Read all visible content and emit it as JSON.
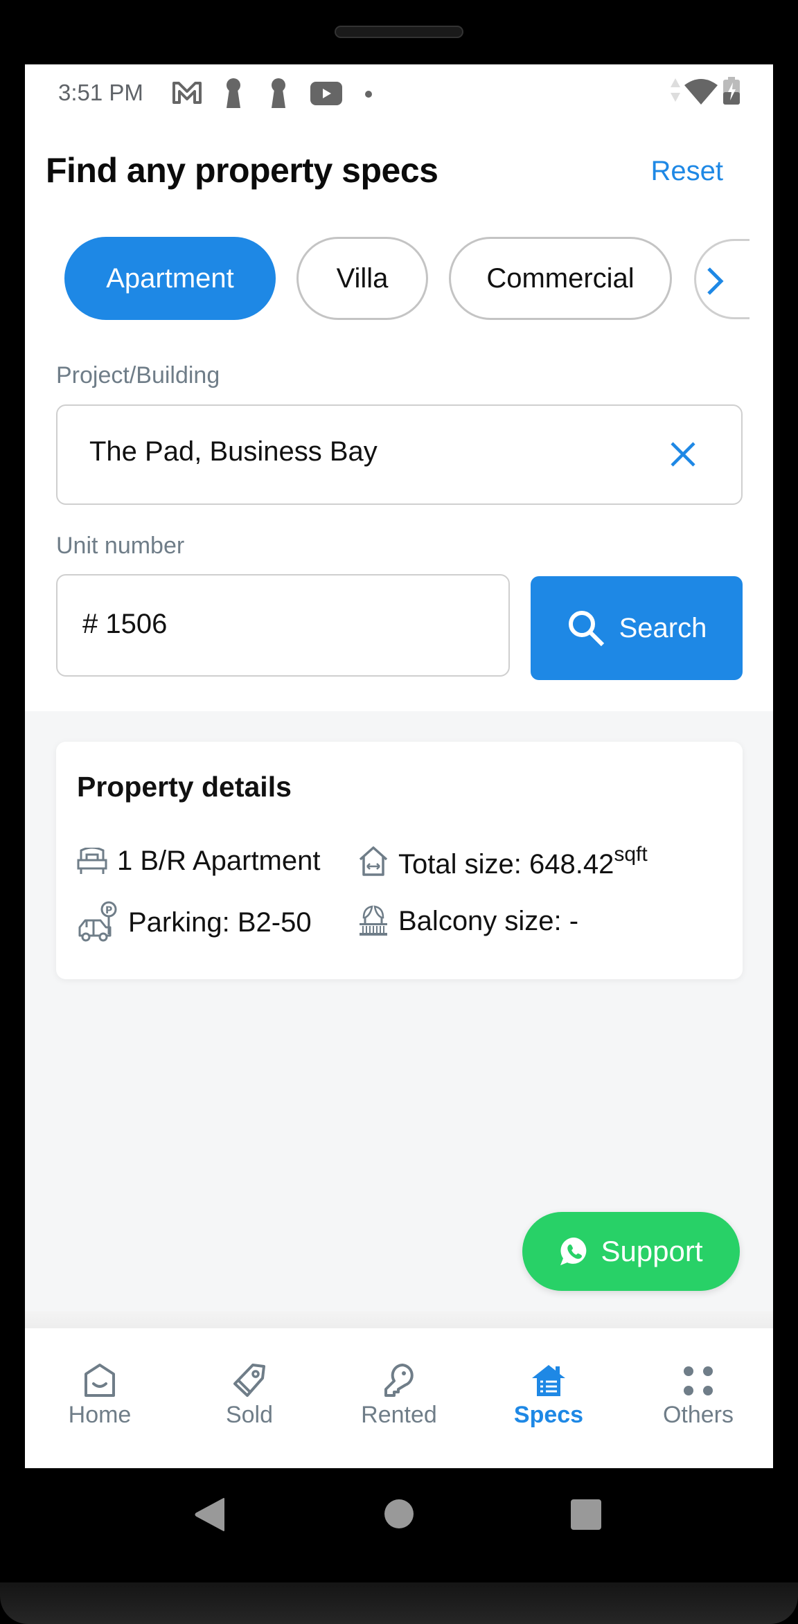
{
  "status_bar": {
    "time": "3:51 PM",
    "left_icons": [
      "gmail-icon",
      "keyhole-icon",
      "keyhole-icon",
      "youtube-icon",
      "dot-icon"
    ],
    "right_icons": [
      "data-arrows-icon",
      "wifi-icon",
      "battery-charging-icon"
    ]
  },
  "header": {
    "title": "Find any property specs",
    "reset_label": "Reset"
  },
  "property_types": {
    "chips": [
      {
        "label": "Apartment",
        "selected": true
      },
      {
        "label": "Villa",
        "selected": false
      },
      {
        "label": "Commercial",
        "selected": false
      }
    ],
    "more_icon": "chevron-right-icon"
  },
  "search_form": {
    "project_label": "Project/Building",
    "project_value": "The Pad, Business Bay",
    "clear_icon": "close-icon",
    "unit_label": "Unit number",
    "unit_value": "# 1506",
    "search_label": "Search"
  },
  "property_details": {
    "title": "Property details",
    "bedrooms": "1 B/R Apartment",
    "total_size_label": "Total size: 648.42",
    "total_size_unit": "sqft",
    "parking": "Parking: B2-50",
    "balcony_size": "Balcony size: -"
  },
  "support": {
    "label": "Support"
  },
  "bottom_nav": {
    "items": [
      {
        "label": "Home",
        "icon": "home-icon",
        "active": false
      },
      {
        "label": "Sold",
        "icon": "tag-icon",
        "active": false
      },
      {
        "label": "Rented",
        "icon": "key-icon",
        "active": false
      },
      {
        "label": "Specs",
        "icon": "house-list-icon",
        "active": true
      },
      {
        "label": "Others",
        "icon": "dots-grid-icon",
        "active": false
      }
    ]
  },
  "colors": {
    "accent": "#1e88e5",
    "support_green": "#28d167",
    "muted_text": "#6f7d88"
  }
}
